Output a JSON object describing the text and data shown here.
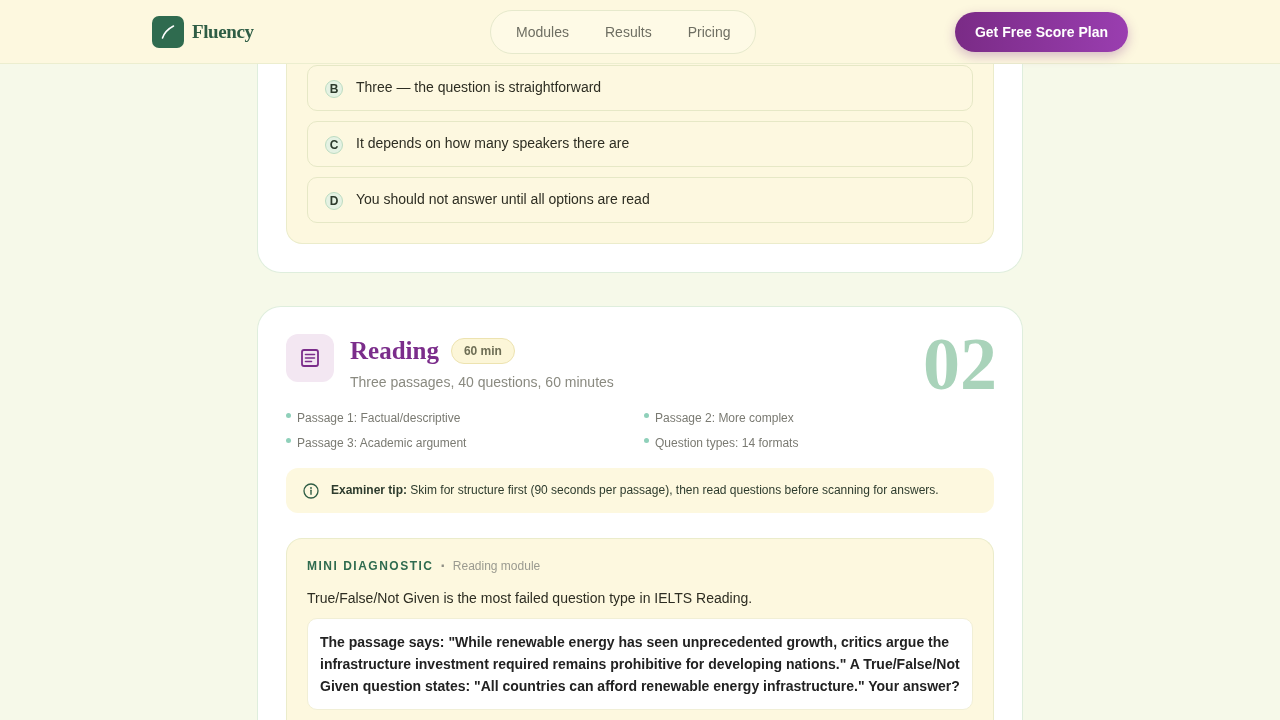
{
  "header": {
    "brand": "Fluency",
    "nav": [
      {
        "label": "Modules"
      },
      {
        "label": "Results"
      },
      {
        "label": "Pricing"
      }
    ],
    "cta": "Get Free Score Plan"
  },
  "previous_module": {
    "diagnostic": {
      "options": [
        {
          "letter": "B",
          "text": "Three — the question is straightforward",
          "selected": false
        },
        {
          "letter": "C",
          "text": "It depends on how many speakers there are",
          "selected": false
        },
        {
          "letter": "D",
          "text": "You should not answer until all options are read",
          "selected": false
        }
      ]
    }
  },
  "module": {
    "title": "Reading",
    "duration": "60 min",
    "subtitle": "Three passages, 40 questions, 60 minutes",
    "number": "02",
    "points": [
      "Passage 1: Factual/descriptive",
      "Passage 2: More complex",
      "Passage 3: Academic argument",
      "Question types: 14 formats"
    ],
    "tip": "**Examiner tip:** Skim for structure first (90 seconds per passage), then read questions before scanning for answers.",
    "diagnostic": {
      "label": "MINI DIAGNOSTIC",
      "separator": "·",
      "module": "Reading module",
      "prompt": "True/False/Not Given is the most failed question type in IELTS Reading.",
      "question": "The passage says: \"While renewable energy has seen unprecedented growth, critics argue the infrastructure investment required remains prohibitive for developing nations.\" A True/False/Not Given question states: \"All countries can afford renewable energy infrastructure.\" Your answer?"
    }
  }
}
